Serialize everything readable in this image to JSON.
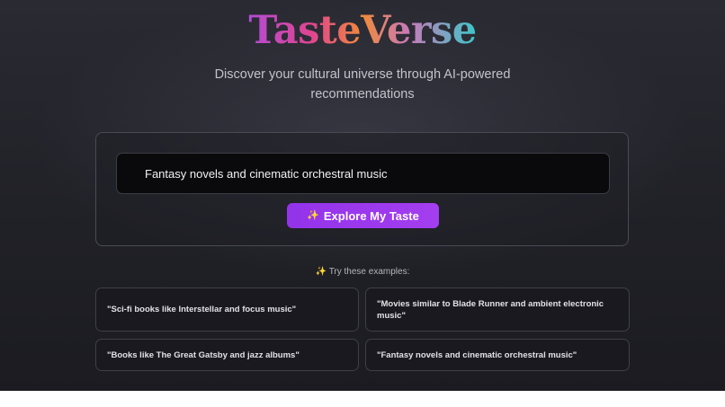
{
  "app": {
    "logo_text": "TasteVerse",
    "subtitle": "Discover your cultural universe through AI-powered recommendations"
  },
  "search": {
    "value": "Fantasy novels and cinematic orchestral music"
  },
  "explore_button": {
    "icon": "sparkle-icon",
    "icon_glyph": "✨",
    "label": "Explore My Taste"
  },
  "examples": {
    "heading_icon": "✨",
    "heading": "Try these examples:",
    "items": [
      {
        "text": "\"Sci-fi books like Interstellar and focus music\""
      },
      {
        "text": "\"Movies similar to Blade Runner and ambient electronic music\""
      },
      {
        "text": "\"Books like The Great Gatsby and jazz albums\""
      },
      {
        "text": "\"Fantasy novels and cinematic orchestral music\""
      }
    ]
  },
  "colors": {
    "background": "#222229",
    "button": "#9333ea",
    "logo_gradient": [
      "#b34bd6",
      "#e0458e",
      "#f08a3a",
      "#3cc7c9"
    ]
  }
}
